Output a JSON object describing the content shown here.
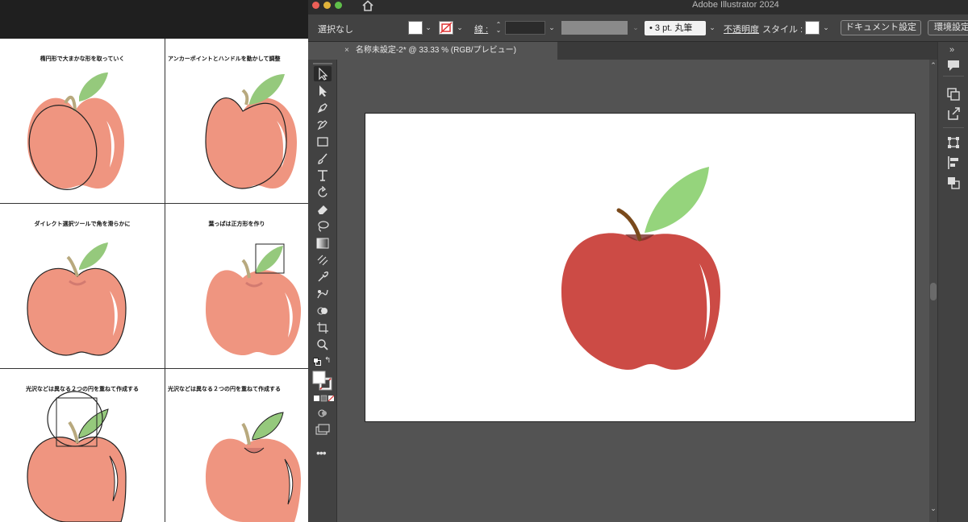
{
  "tutorial": {
    "captions": [
      "楕円形で大まかな形を取っていく",
      "アンカーポイントとハンドルを動かして調整",
      "ダイレクト選択ツールで角を滑らかに",
      "葉っぱは正方形を作り",
      "光沢などは異なる２つの円を重ねて作成する",
      "光沢などは異なる２つの円を重ねて作成する"
    ]
  },
  "app": {
    "title": "Adobe Illustrator 2024"
  },
  "control_bar": {
    "selection_label": "選択なし",
    "stroke_label": "線 :",
    "brush_value": "•  3 pt. 丸筆",
    "opacity_label": "不透明度",
    "style_label": "スタイル :",
    "document_setup_button": "ドキュメント設定",
    "preferences_button": "環境設定"
  },
  "document_tab": {
    "close_glyph": "×",
    "title": "名称未設定-2* @ 33.33 % (RGB/プレビュー)"
  },
  "colors": {
    "apple_red": "#cc4b45",
    "apple_light": "#ef9580",
    "leaf_green": "#95d47c",
    "stem_brown": "#7a4a1c",
    "ui_dark": "#424242",
    "canvas_gray": "#535353"
  },
  "icons": {
    "toolbar": [
      "selection-tool",
      "direct-selection-tool",
      "pen-tool",
      "curvature-tool",
      "rectangle-tool",
      "paintbrush-tool",
      "type-tool",
      "rotate-tool",
      "eraser-tool",
      "lasso-tool",
      "gradient-tool",
      "eyedropper-tool",
      "blend-tool",
      "width-tool",
      "shape-builder-tool",
      "artboard-tool",
      "zoom-tool"
    ],
    "dock": [
      "comments-icon",
      "arrange-icon",
      "export-icon",
      "transform-icon",
      "align-icon",
      "pathfinder-icon"
    ]
  }
}
